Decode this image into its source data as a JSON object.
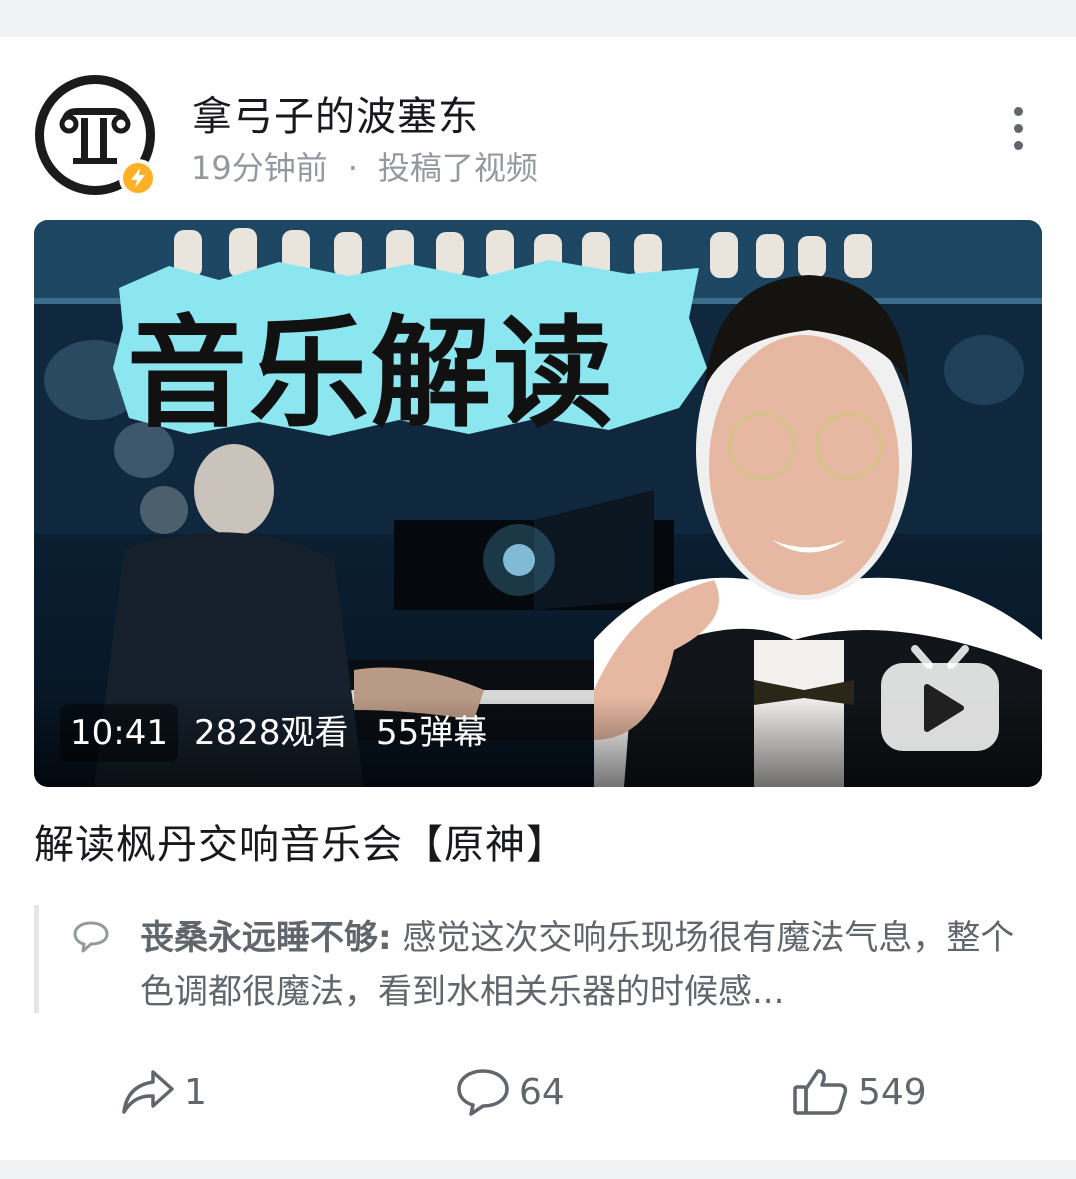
{
  "post": {
    "author_name": "拿弓子的波塞东",
    "time_ago": "19分钟前",
    "separator": "·",
    "action_text": "投稿了视频",
    "title": "解读枫丹交响音乐会【原神】"
  },
  "video": {
    "overlay_text": "音乐解读",
    "duration": "10:41",
    "views": "2828观看",
    "danmaku": "55弹幕"
  },
  "comment": {
    "author": "丧桑永远睡不够:",
    "text": " 感觉这次交响乐现场很有魔法气息，整个色调都很魔法，看到水相关乐器的时候感..."
  },
  "actions": {
    "share_count": "1",
    "comment_count": "64",
    "like_count": "549"
  },
  "colors": {
    "badge": "#ffb027",
    "text_secondary": "#9499a0",
    "background": "#f1f2f4"
  }
}
